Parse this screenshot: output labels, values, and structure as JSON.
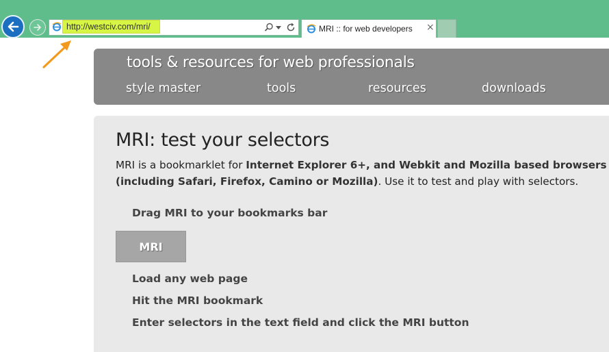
{
  "browser": {
    "url": "http://westciv.com/mri/",
    "tab_title": "MRI :: for web developers",
    "tab_close_glyph": "×",
    "icons": [
      "back-arrow-icon",
      "forward-arrow-icon",
      "ie-page-icon",
      "search-icon",
      "chevron-down-icon",
      "refresh-icon",
      "close-icon"
    ],
    "chrome_color": "#5ebd8a",
    "url_highlight_color": "#d7f545",
    "annotation_arrow_color": "#f39a1e"
  },
  "site": {
    "tagline": "tools & resources for web professionals",
    "nav": [
      {
        "label": "style master"
      },
      {
        "label": "tools"
      },
      {
        "label": "resources"
      },
      {
        "label": "downloads"
      }
    ],
    "header_color": "#888888"
  },
  "main": {
    "title": "MRI: test your selectors",
    "intro_prefix": "MRI is a bookmarklet for ",
    "intro_bold": "Internet Explorer 6+, and Webkit and Mozilla based browsers (including Safari, Firefox, Camino or Mozilla)",
    "intro_suffix": ". Use it to test and play with selectors.",
    "step_drag": "Drag MRI to your bookmarks bar",
    "mri_button_label": "MRI",
    "steps": [
      "Load any web page",
      "Hit the MRI bookmark",
      "Enter selectors in the text field and click the MRI button"
    ],
    "content_bg": "#e9e9e9"
  }
}
